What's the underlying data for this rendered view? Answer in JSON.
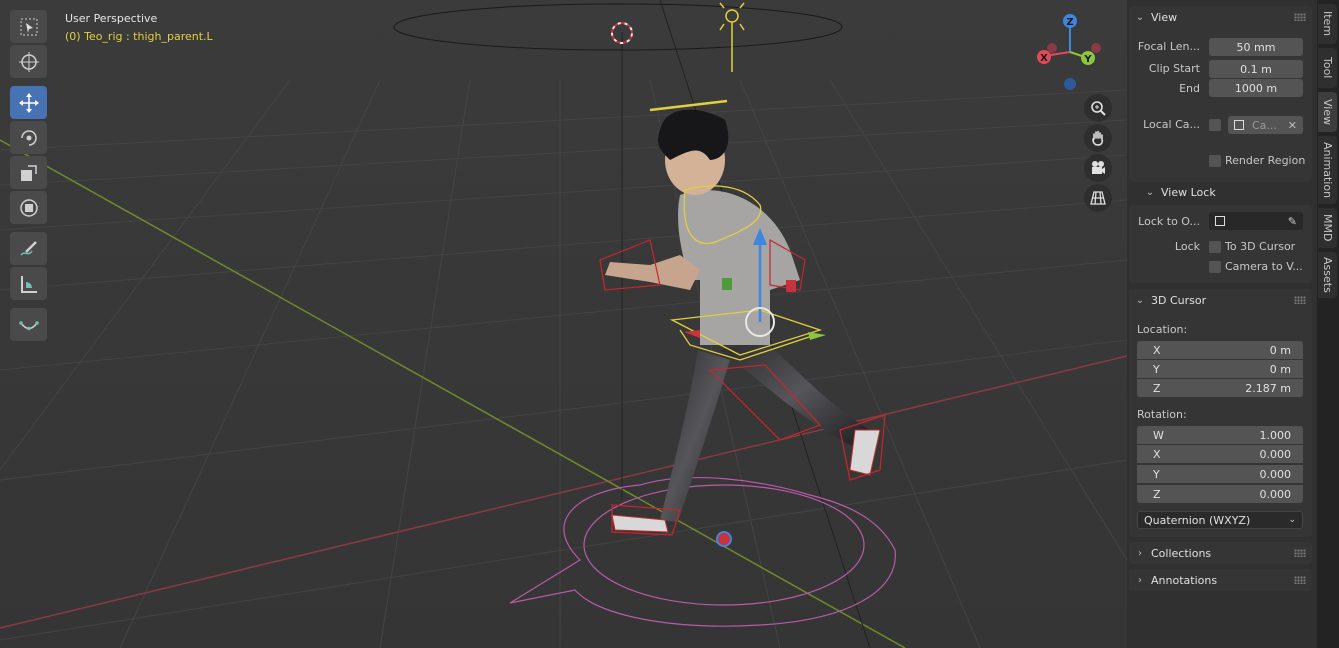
{
  "viewport": {
    "title": "User Perspective",
    "active_object": "(0) Teo_rig : thigh_parent.L"
  },
  "toolbar": {
    "tools": [
      {
        "name": "select-box-icon"
      },
      {
        "name": "cursor-icon"
      },
      {
        "name": "move-icon",
        "active": true
      },
      {
        "name": "rotate-icon"
      },
      {
        "name": "scale-icon"
      },
      {
        "name": "transform-icon"
      },
      {
        "name": "annotate-icon"
      },
      {
        "name": "measure-icon"
      },
      {
        "name": "pose-relax-icon"
      }
    ]
  },
  "gizmo": {
    "z_label": "Z",
    "x_label": "X",
    "y_label": "Y",
    "x_color": "#e04a5a",
    "y_color": "#8cc63e",
    "z_color": "#3f86e0"
  },
  "nav_buttons": [
    "zoom-icon",
    "hand-icon",
    "camera-icon",
    "grid-icon"
  ],
  "sidebar": {
    "view": {
      "header": "View",
      "focal_label": "Focal Len...",
      "focal_value": "50 mm",
      "clip_start_label": "Clip Start",
      "clip_start_value": "0.1 m",
      "end_label": "End",
      "end_value": "1000 m",
      "local_cam_label": "Local Ca...",
      "local_cam_value": "Ca...",
      "render_region_label": "Render Region"
    },
    "view_lock": {
      "header": "View Lock",
      "lock_to_label": "Lock to O...",
      "lock_label": "Lock",
      "to_cursor_label": "To 3D Cursor",
      "camera_label": "Camera to V..."
    },
    "cursor": {
      "header": "3D Cursor",
      "location_label": "Location:",
      "loc": [
        {
          "axis": "X",
          "value": "0 m"
        },
        {
          "axis": "Y",
          "value": "0 m"
        },
        {
          "axis": "Z",
          "value": "2.187 m"
        }
      ],
      "rotation_label": "Rotation:",
      "rot": [
        {
          "axis": "W",
          "value": "1.000"
        },
        {
          "axis": "X",
          "value": "0.000"
        },
        {
          "axis": "Y",
          "value": "0.000"
        },
        {
          "axis": "Z",
          "value": "0.000"
        }
      ],
      "mode": "Quaternion (WXYZ)"
    },
    "collections": "Collections",
    "annotations": "Annotations"
  },
  "tabs": [
    "Item",
    "Tool",
    "View",
    "Animation",
    "MMD",
    "Assets"
  ],
  "colors": {
    "accent": "#4772b3",
    "bone_select": "#e0d040"
  }
}
